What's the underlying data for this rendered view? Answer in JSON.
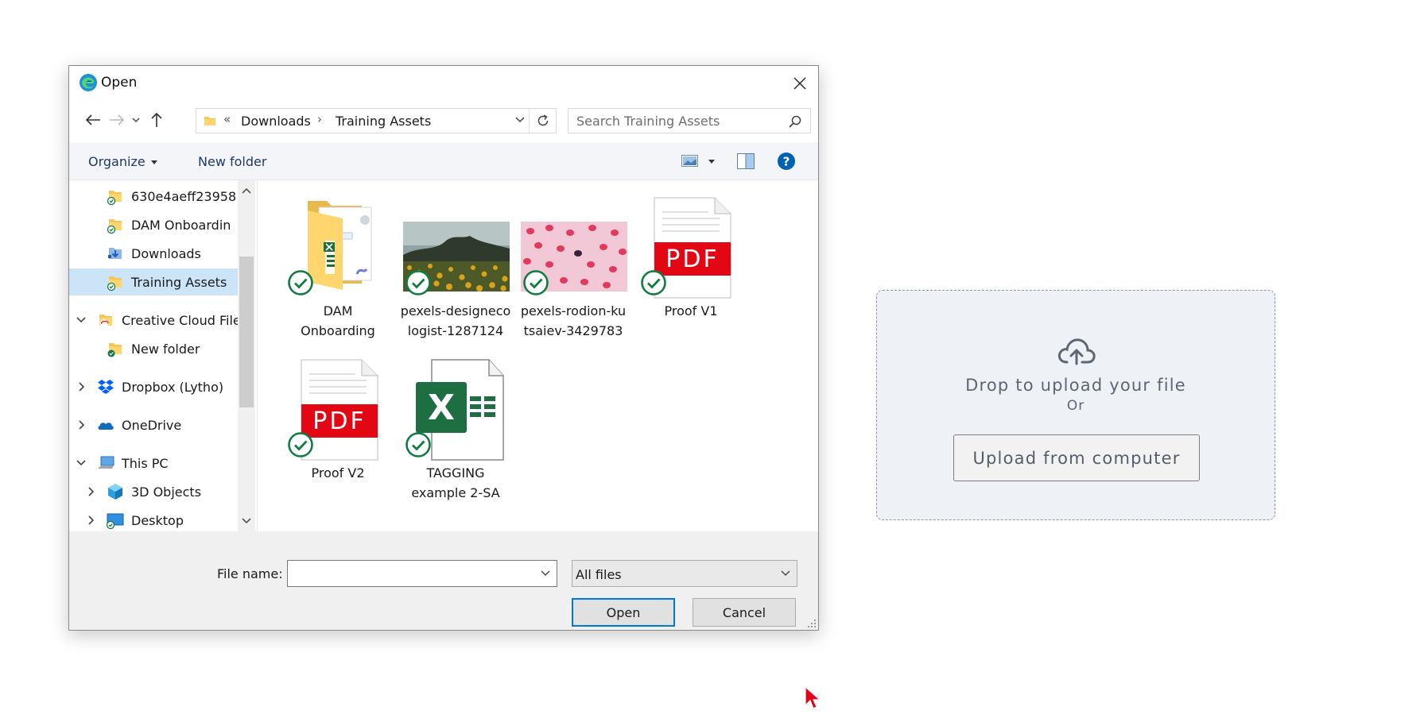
{
  "dialog": {
    "title": "Open",
    "address": {
      "crumbs": [
        "Downloads",
        "Training Assets"
      ]
    },
    "search": {
      "placeholder": "Search Training Assets"
    },
    "toolbar": {
      "organize": "Organize",
      "new_folder": "New folder"
    },
    "nav_items": [
      {
        "label": "630e4aeff23958",
        "icon": "folder-synced-icon"
      },
      {
        "label": "DAM Onboardin",
        "icon": "folder-synced-icon"
      },
      {
        "label": "Downloads",
        "icon": "downloads-icon"
      },
      {
        "label": "Training Assets",
        "icon": "folder-synced-icon",
        "selected": true
      },
      {
        "label": "Creative Cloud File",
        "icon": "creative-cloud-folder-icon",
        "expanded": true
      },
      {
        "label": "New folder",
        "icon": "folder-synced-icon"
      },
      {
        "label": "Dropbox (Lytho)",
        "icon": "dropbox-icon"
      },
      {
        "label": "OneDrive",
        "icon": "onedrive-icon"
      },
      {
        "label": "This PC",
        "icon": "computer-icon",
        "expanded": true
      },
      {
        "label": "3D Objects",
        "icon": "3d-objects-icon"
      },
      {
        "label": "Desktop",
        "icon": "desktop-icon"
      }
    ],
    "files": [
      {
        "name_line1": "DAM",
        "name_line2": "Onboarding",
        "kind": "folder"
      },
      {
        "name_line1": "pexels-designeco",
        "name_line2": "logist-1287124",
        "kind": "image-sunflowers"
      },
      {
        "name_line1": "pexels-rodion-ku",
        "name_line2": "tsaiev-3429783",
        "kind": "image-raspberries"
      },
      {
        "name_line1": "Proof  V1",
        "name_line2": "",
        "kind": "pdf",
        "badge": "PDF"
      },
      {
        "name_line1": "Proof V2",
        "name_line2": "",
        "kind": "pdf",
        "badge": "PDF"
      },
      {
        "name_line1": "TAGGING",
        "name_line2": "example 2-SA",
        "kind": "excel",
        "badge": "X"
      }
    ],
    "file_name_label": "File name:",
    "file_name_value": "",
    "filter": "All files",
    "open_button": "Open",
    "cancel_button": "Cancel"
  },
  "upload": {
    "drop_text": "Drop to upload your file",
    "or_text": "Or",
    "button": "Upload from computer"
  },
  "colors": {
    "selection": "#cce4f7",
    "sync_green": "#107c41",
    "pdf_red": "#e30613",
    "excel_green": "#1d6f42",
    "help_blue": "#0063b1",
    "upload_bg": "#eef1f5"
  }
}
